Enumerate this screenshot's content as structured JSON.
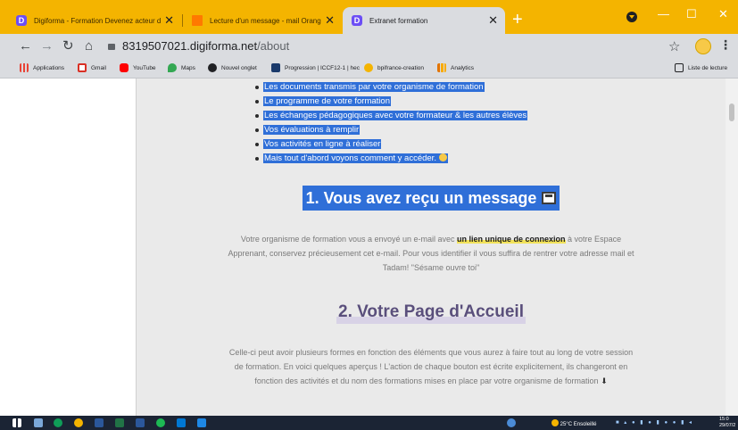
{
  "browser": {
    "tabs": [
      {
        "title": "Digiforma - Formation Devenez acteur de votre",
        "favicon": "digiforma-icon",
        "favicon_color": "#6c4ef5"
      },
      {
        "title": "Lecture d'un message - mail Orange",
        "favicon": "orange-icon",
        "favicon_color": "#ff7900"
      },
      {
        "title": "Extranet formation",
        "favicon": "digiforma-icon",
        "favicon_color": "#6c4ef5"
      }
    ],
    "new_tab": "+",
    "close_glyph": "✕",
    "window_controls": {
      "minimize": "—",
      "maximize": "☐",
      "close": "✕"
    },
    "url_host": "8319507021.digiforma.net",
    "url_path": "/about",
    "bookmarks": [
      {
        "label": "Applications",
        "icon": "apps-grid-icon",
        "color": "#e94235"
      },
      {
        "label": "Gmail",
        "icon": "gmail-icon",
        "color": "#d93025"
      },
      {
        "label": "YouTube",
        "icon": "youtube-icon",
        "color": "#ff0000"
      },
      {
        "label": "Maps",
        "icon": "maps-icon",
        "color": "#34a853"
      },
      {
        "label": "Nouvel onglet",
        "icon": "globe-icon",
        "color": "#202124"
      },
      {
        "label": "Progression | ICCF12-1 | hec",
        "icon": "hec-icon",
        "color": "#1a3a6b"
      },
      {
        "label": "bpifrance-creation",
        "icon": "bpi-icon",
        "color": "#f4b400"
      },
      {
        "label": "Analytics",
        "icon": "analytics-icon",
        "color": "#f9ab00"
      }
    ],
    "reading_list": "Liste de lecture"
  },
  "content": {
    "bullets": [
      "Les documents transmis par votre organisme de formation",
      "Le programme de votre formation",
      "Les échanges pédagogiques avec votre formateur & les autres élèves",
      "Vos évaluations à remplir",
      "Vos activités en ligne à réaliser",
      "Mais tout d'abord voyons comment y accéder."
    ],
    "heading1": "1. Vous avez reçu un message",
    "para1_before": "Votre organisme de formation vous a envoyé un e-mail avec ",
    "para1_bold": "un lien unique de connexion",
    "para1_after": " à votre Espace Apprenant, conservez précieusement cet e-mail. Pour vous identifier il vous suffira de rentrer votre adresse mail et Tadam! \"Sésame ouvre toi\"",
    "heading2": "2. Votre Page d'Accueil",
    "para2": "Celle-ci peut avoir plusieurs formes en fonction des éléments que vous aurez à faire tout au long de votre session de formation. En voici quelques aperçus ! L'action de chaque bouton est écrite explicitement, ils changeront en fonction des activités et du nom des formations mises en place par votre organisme de formation",
    "para2_arrow": "⬇"
  },
  "taskbar": {
    "weather": "25°C Ensoleillé",
    "time": "15:0",
    "date": "29/07/2"
  },
  "colors": {
    "tabbar": "#f4b400",
    "selection": "#2f6fd8",
    "heading2": "#5a4f7c"
  }
}
